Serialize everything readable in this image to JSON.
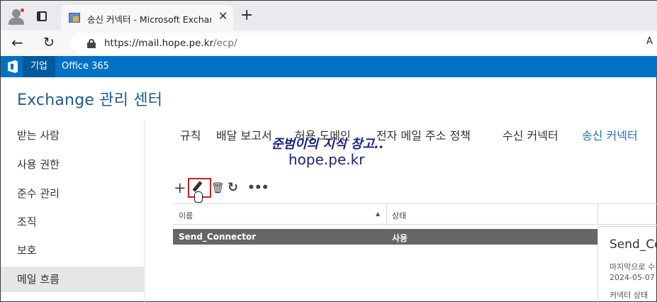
{
  "browser": {
    "tab_title": "송신 커넥터 - Microsoft Exchange",
    "tab_close": "✕",
    "new_tab": "+",
    "back": "←",
    "reload": "↻",
    "url_host": "https://mail.hope.pe.kr",
    "url_path": "/ecp/",
    "read_aloud": "A"
  },
  "header": {
    "enterprise_label": "기업",
    "office365_label": "Office 365",
    "app_title": "Exchange 관리 센터",
    "brand_color": "#0072c6"
  },
  "sidebar": {
    "items": [
      {
        "label": "받는 사람"
      },
      {
        "label": "사용 권한"
      },
      {
        "label": "준수 관리"
      },
      {
        "label": "조직"
      },
      {
        "label": "보호"
      },
      {
        "label": "메일 흐름",
        "active": true
      }
    ]
  },
  "tabs": [
    {
      "label": "규칙"
    },
    {
      "label": "배달 보고서"
    },
    {
      "label": "허용 도메인"
    },
    {
      "label": "전자 메일 주소 정책"
    },
    {
      "label": "수신 커넥터"
    },
    {
      "label": "송신 커넥터",
      "active": true
    }
  ],
  "watermark": {
    "line1": "준범이의 지식 창고..",
    "line2": "hope.pe.kr"
  },
  "toolbar": {
    "add": "+",
    "delete": "🗑",
    "refresh": "↻",
    "more": "•••",
    "icons": [
      "add-icon",
      "pencil-icon",
      "trash-icon",
      "refresh-icon",
      "more-icon"
    ]
  },
  "table": {
    "columns": [
      "이름",
      "상태"
    ],
    "sort_indicator": "▲",
    "rows": [
      {
        "name": "Send_Connector",
        "state": "사용",
        "selected": true
      }
    ]
  },
  "details": {
    "title": "Send_Connector",
    "last_modified_label": "마지막으로 수정한 날짜:",
    "date": "2024-05-07",
    "status_label": "커넥터 상태"
  }
}
